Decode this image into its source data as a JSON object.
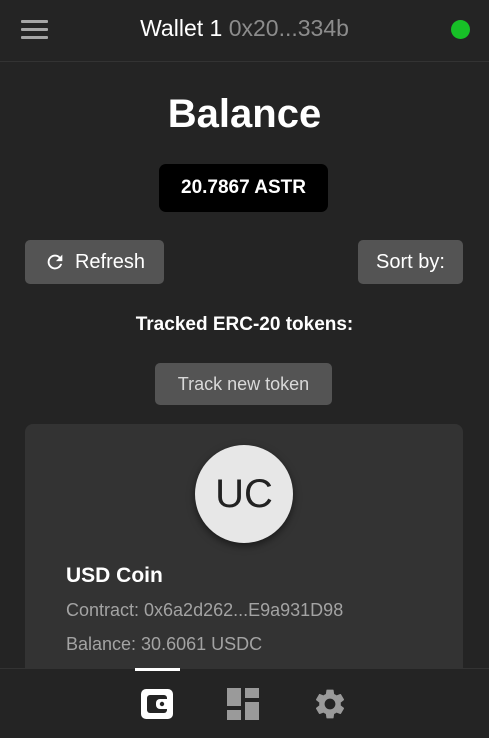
{
  "header": {
    "wallet_name": "Wallet 1",
    "wallet_address": "0x20...334b",
    "status_color": "#17c027",
    "menu_icon": "hamburger-menu-icon"
  },
  "balance": {
    "title": "Balance",
    "amount": "20.7867 ASTR"
  },
  "actions": {
    "refresh_label": "Refresh",
    "refresh_icon": "refresh-icon",
    "sort_label": "Sort by:"
  },
  "tokens": {
    "heading": "Tracked ERC-20 tokens:",
    "track_new_label": "Track new token",
    "items": [
      {
        "initials": "UC",
        "name": "USD Coin",
        "contract": "Contract: 0x6a2d262...E9a931D98",
        "balance": "Balance: 30.6061 USDC"
      }
    ]
  },
  "nav": {
    "items": [
      {
        "icon": "wallet-icon",
        "active": true
      },
      {
        "icon": "dashboard-icon",
        "active": false
      },
      {
        "icon": "gear-icon",
        "active": false
      }
    ]
  },
  "colors": {
    "background": "#242424",
    "card": "#333333",
    "button": "#545454",
    "accent_status": "#17c027"
  }
}
